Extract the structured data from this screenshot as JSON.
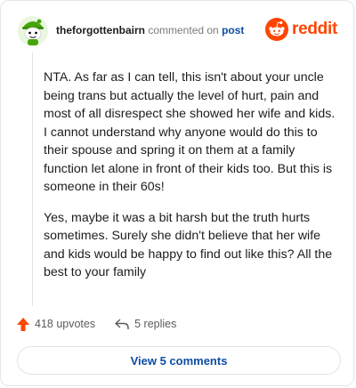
{
  "comment": {
    "username": "theforgottenbairn",
    "action_text": "commented on",
    "post_link": "post",
    "brand": "reddit",
    "paragraphs": [
      "NTA. As far as I can tell, this isn't about your uncle being trans but actually the level of hurt, pain and most of all disrespect she showed her wife and kids. I cannot understand why anyone would do this to their spouse and spring it on them at a family function let alone in front of their kids too. But this is someone in their 60s!",
      "Yes, maybe it was a bit harsh but the truth hurts sometimes. Surely she didn't believe that her wife and kids would be happy to find out like this? All the best to your family"
    ]
  },
  "footer": {
    "upvotes": "418 upvotes",
    "replies": "5 replies",
    "view_comments": "View 5 comments"
  },
  "colors": {
    "brand_orange": "#ff4500",
    "link_blue": "#0e4da3",
    "avatar_green": "#46a508"
  },
  "icons": [
    "avatar-icon",
    "reddit-logo-icon",
    "upvote-arrow-icon",
    "reply-arrow-icon"
  ]
}
